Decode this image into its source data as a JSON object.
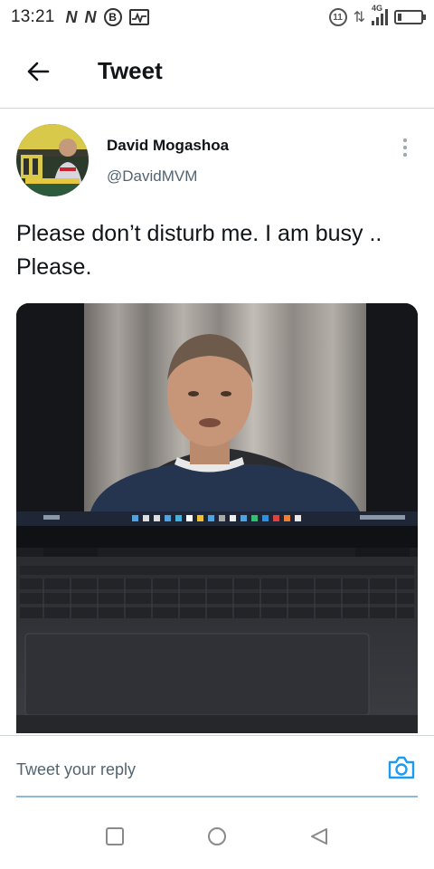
{
  "status_bar": {
    "time": "13:21",
    "left_icons": [
      "N",
      "N",
      "B",
      "pulse-icon"
    ],
    "badge_b": "B",
    "network_badge": "4G",
    "sim_badge": "11",
    "icons": [
      "sim-icon",
      "data-arrows-icon",
      "signal-icon",
      "battery-icon"
    ]
  },
  "header": {
    "back_icon": "arrow-left-icon",
    "title": "Tweet"
  },
  "tweet": {
    "author": {
      "name": "David Mogashoa",
      "handle": "@DavidMVM"
    },
    "more_icon": "more-vertical-icon",
    "text": "Please don’t disturb me. I am busy .. Please.",
    "media": {
      "description_icon": "photo-icon"
    }
  },
  "reply": {
    "placeholder": "Tweet your reply",
    "camera_icon": "camera-icon"
  },
  "nav": {
    "items": [
      "recents-icon",
      "home-icon",
      "back-icon"
    ]
  },
  "colors": {
    "accent": "#1d9bf0",
    "text_primary": "#0f1419",
    "text_secondary": "#536471",
    "divider": "#d0d7dc"
  }
}
